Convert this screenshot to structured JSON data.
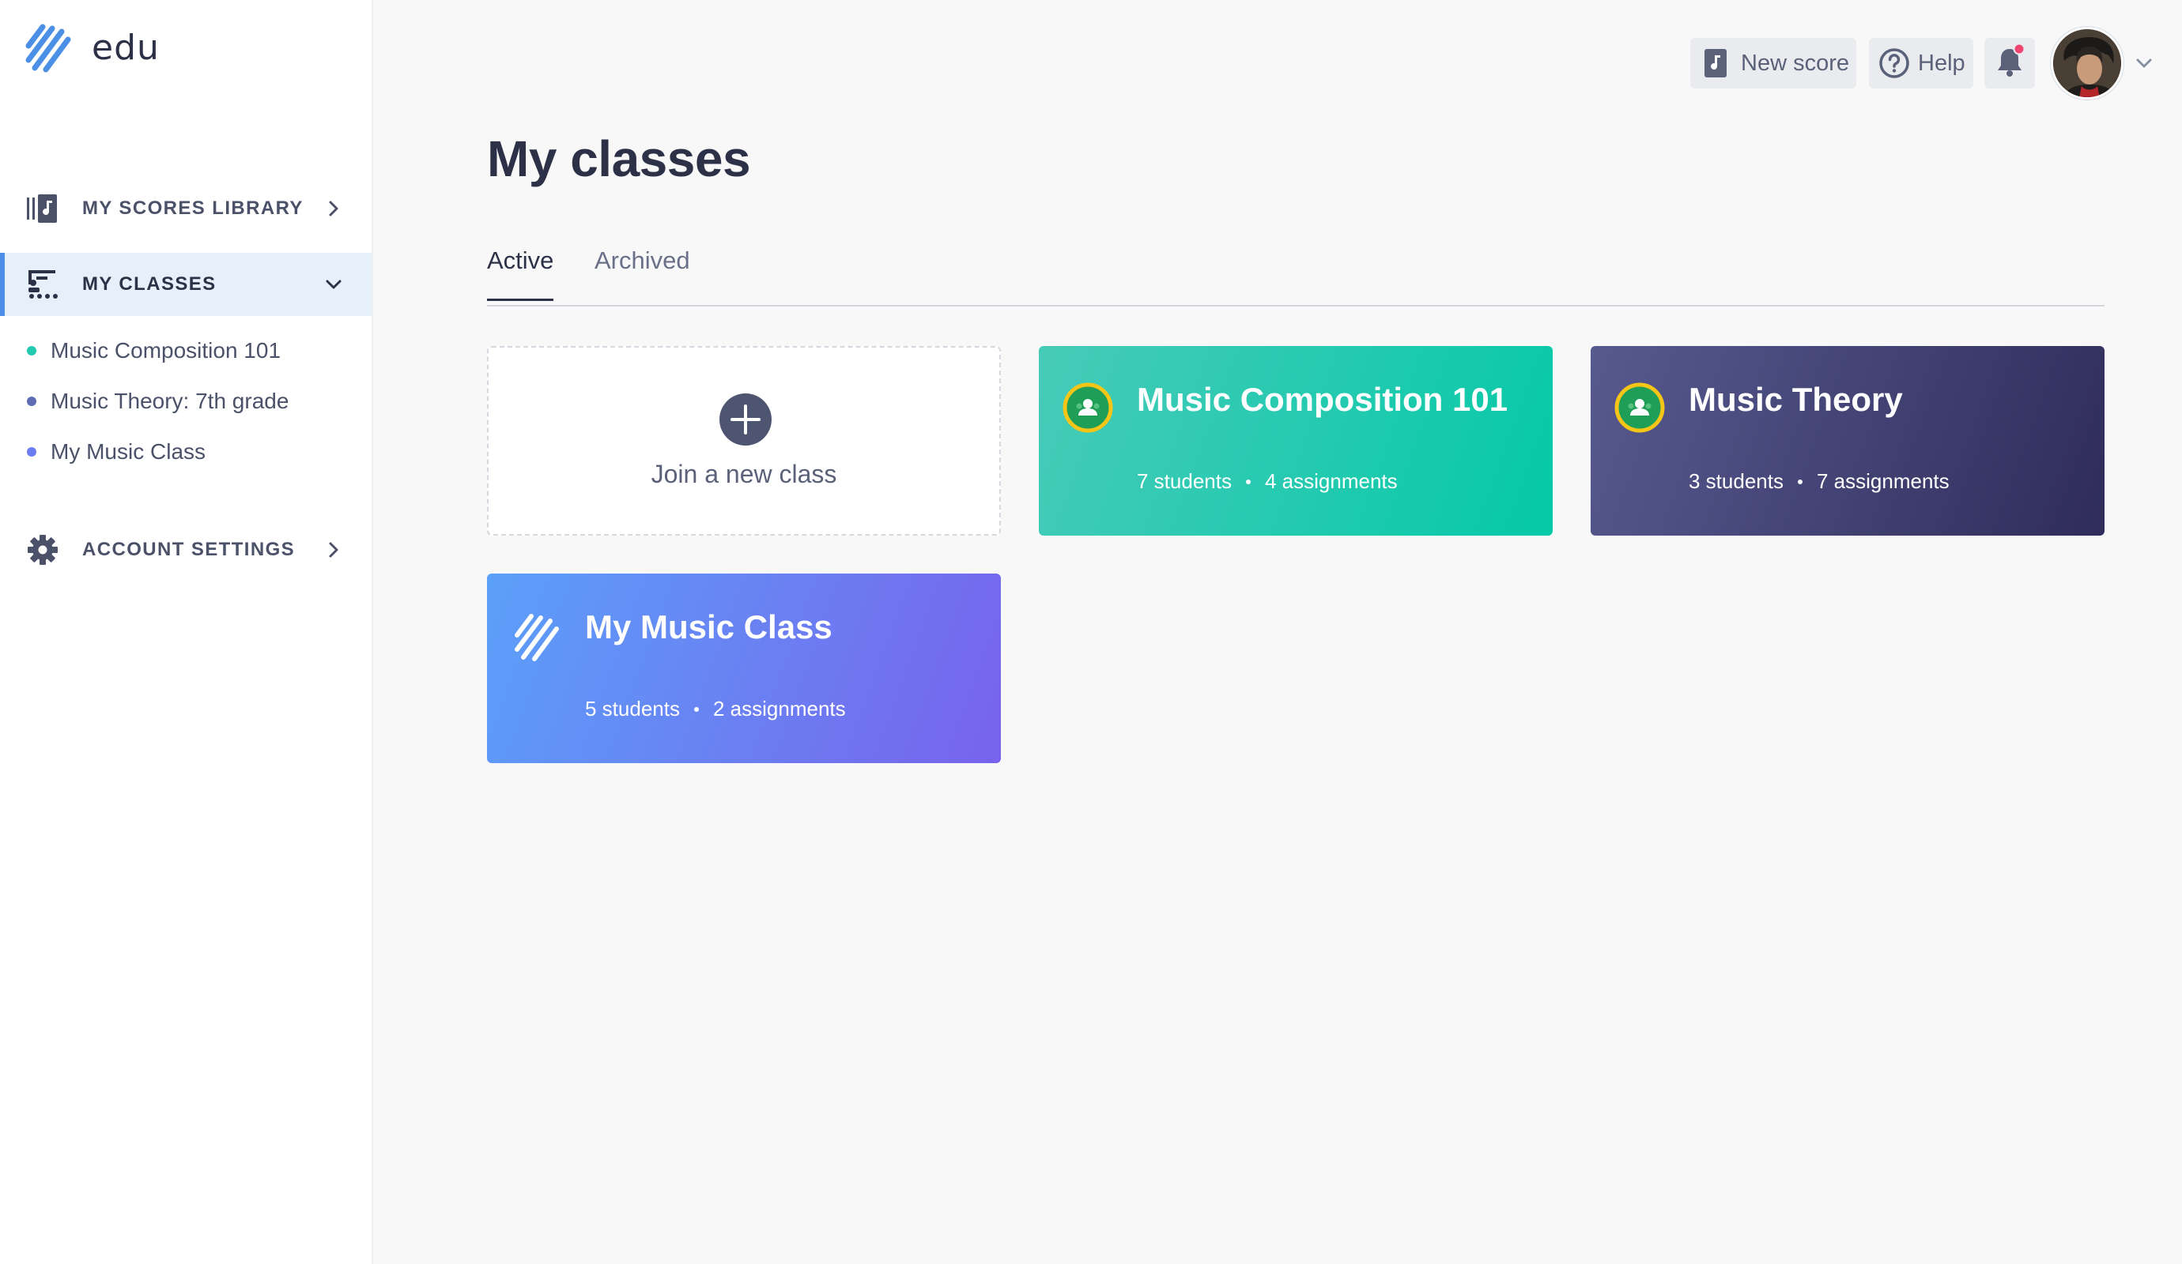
{
  "app": {
    "logo_text": "edu"
  },
  "sidebar": {
    "items": [
      {
        "label": "MY SCORES LIBRARY",
        "icon": "scores-library-icon"
      },
      {
        "label": "MY CLASSES",
        "icon": "classes-icon",
        "active": true
      },
      {
        "label": "ACCOUNT SETTINGS",
        "icon": "gear-icon"
      }
    ],
    "classes": [
      {
        "label": "Music Composition 101",
        "dot_color": "#25c9b0"
      },
      {
        "label": "Music Theory: 7th grade",
        "dot_color": "#5f6bb5"
      },
      {
        "label": "My Music Class",
        "dot_color": "#6d7cf0"
      }
    ]
  },
  "header": {
    "new_score_label": "New score",
    "help_label": "Help",
    "notification_dot_color": "#f0456e"
  },
  "main": {
    "title": "My classes",
    "tabs": [
      {
        "label": "Active",
        "active": true
      },
      {
        "label": "Archived",
        "active": false
      }
    ],
    "join_card": {
      "label": "Join a new class"
    },
    "cards": [
      {
        "title": "Music Composition 101",
        "students": "7 students",
        "assignments": "4 assignments",
        "icon": "google-classroom-icon",
        "gradient": [
          "#47cbb9",
          "#05c9a7"
        ]
      },
      {
        "title": "Music Theory",
        "students": "3 students",
        "assignments": "7 assignments",
        "icon": "google-classroom-icon",
        "gradient": [
          "#575a8f",
          "#2f2c5a"
        ]
      },
      {
        "title": "My Music Class",
        "students": "5 students",
        "assignments": "2 assignments",
        "icon": "edu-logo-icon",
        "gradient": [
          "#5ba0f9",
          "#7863ec"
        ]
      }
    ]
  }
}
